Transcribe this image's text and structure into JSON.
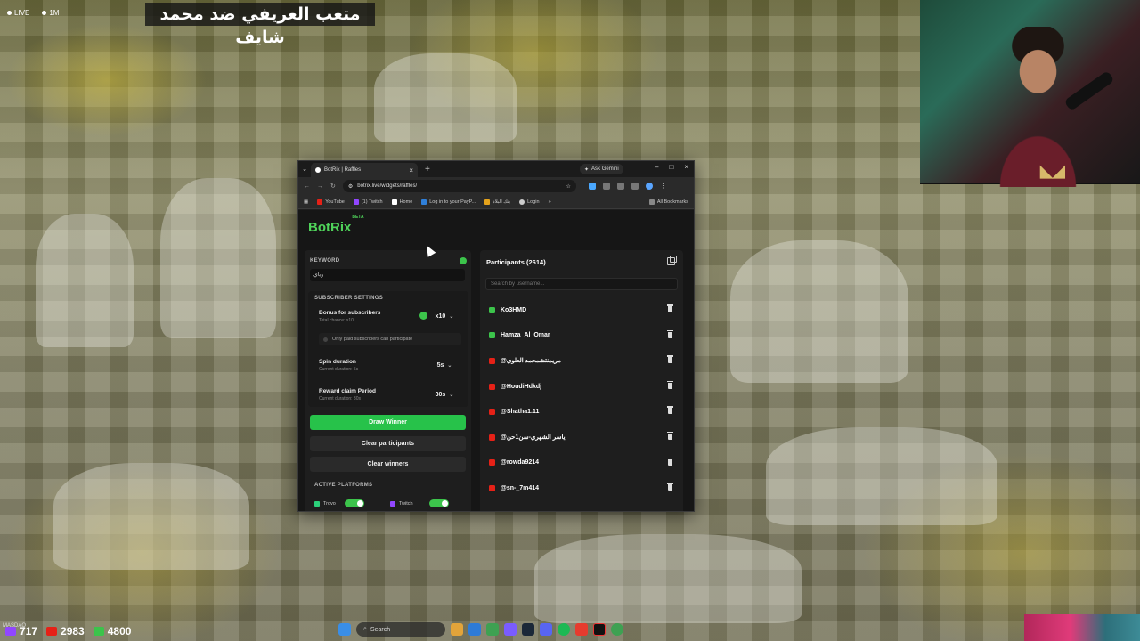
{
  "overlay": {
    "live_label": "LIVE",
    "viewers": "1M",
    "caption": "متعب العريفي ضد محمد شايف"
  },
  "stats": {
    "handle": "MASDAQ",
    "first": "717",
    "youtube": "2983",
    "kick": "4800"
  },
  "taskbar": {
    "search_label": "Search"
  },
  "browser": {
    "tab_title": "BotRix | Raffles",
    "ask_gemini": "Ask Gemini",
    "url": "botrix.live/widgets/raffles/",
    "bookmarks": [
      "YouTube",
      "(1) Twitch",
      "Home",
      "Log in to your PayP...",
      "بنك البلاد",
      "Login"
    ],
    "all_bookmarks": "All Bookmarks"
  },
  "app": {
    "brand": "BotRix",
    "beta": "BETA",
    "keyword_label": "KEYWORD",
    "keyword_value": "وياي",
    "subscriber_settings_label": "SUBSCRIBER SETTINGS",
    "bonus": {
      "title": "Bonus for subscribers",
      "subtitle": "Total chance: x10",
      "value": "x10"
    },
    "paid_only": "Only paid subscribers can participate",
    "spin": {
      "title": "Spin duration",
      "subtitle": "Current duration: 5s",
      "value": "5s"
    },
    "claim": {
      "title": "Reward claim Period",
      "subtitle": "Current duration: 30s",
      "value": "30s"
    },
    "buttons": {
      "draw": "Draw Winner",
      "clear_participants": "Clear participants",
      "clear_winners": "Clear winners"
    },
    "platforms_label": "ACTIVE PLATFORMS",
    "platforms": [
      "Trovo",
      "Twitch"
    ],
    "participants_title": "Participants (2614)",
    "search_placeholder": "Search by username...",
    "participants": [
      {
        "name": "Ko3HMD",
        "platform": "kick"
      },
      {
        "name": "Hamza_Al_Omar",
        "platform": "kick"
      },
      {
        "name": "@مريمنتشمحمد العلوي",
        "platform": "youtube"
      },
      {
        "name": "@HoudiHdkdj",
        "platform": "youtube"
      },
      {
        "name": "@Shatha1.11",
        "platform": "youtube"
      },
      {
        "name": "@ياسر الشهري-سن1حن",
        "platform": "youtube"
      },
      {
        "name": "@rowda9214",
        "platform": "youtube"
      },
      {
        "name": "@sn-_7m414",
        "platform": "youtube"
      }
    ]
  },
  "colors": {
    "accent_green": "#27c24a",
    "kick_green": "#3cc44b",
    "youtube_red": "#e62117"
  }
}
